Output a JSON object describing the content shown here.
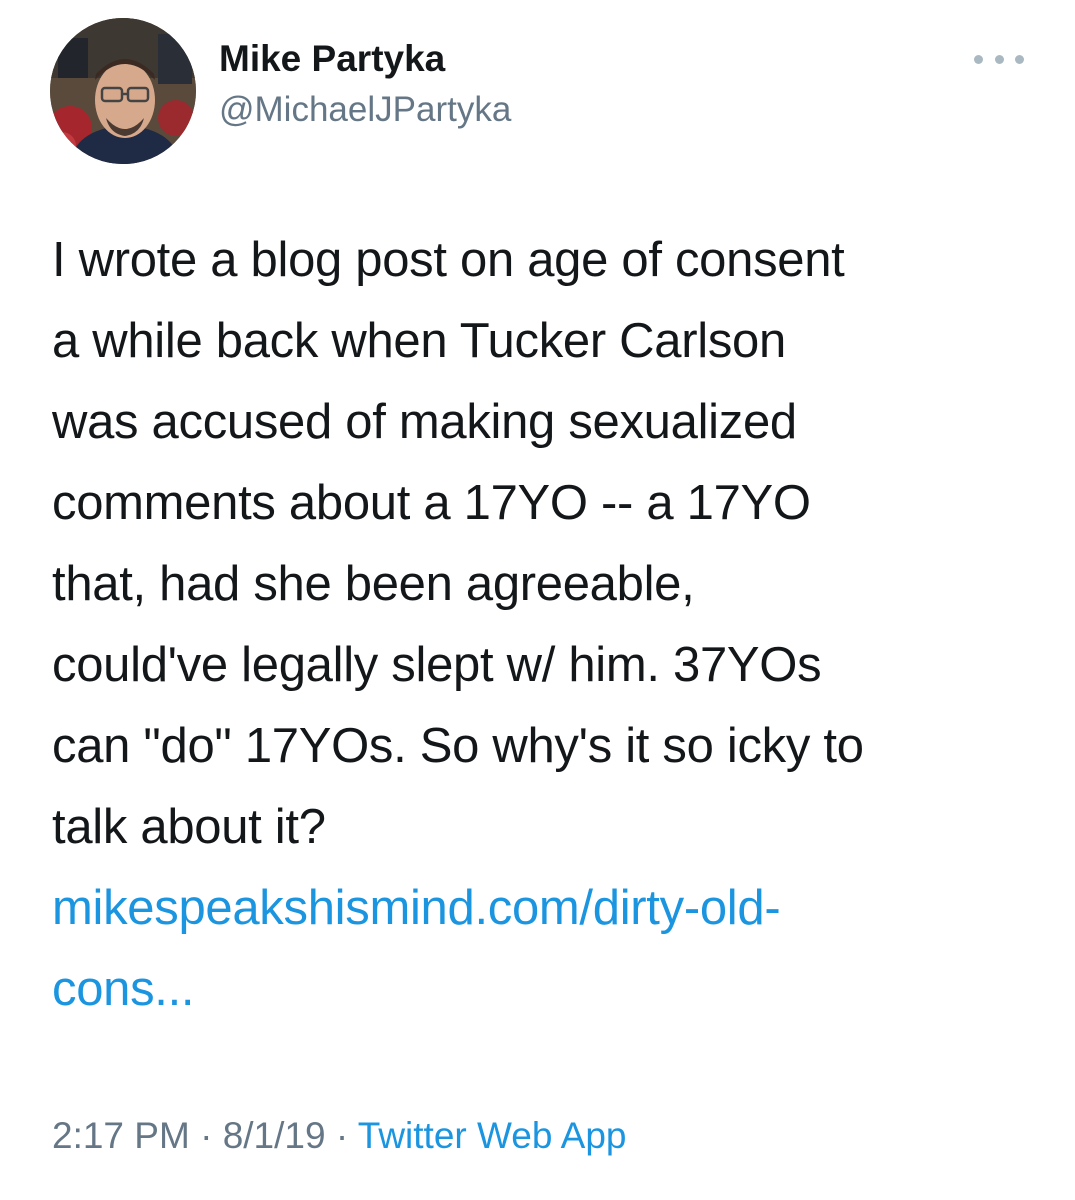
{
  "author": {
    "display_name": "Mike Partyka",
    "handle": "@MichaelJPartyka"
  },
  "tweet": {
    "text": "I wrote a blog post on age of consent\na while back when Tucker Carlson\nwas accused of making sexualized\ncomments about a 17YO -- a 17YO\nthat, had she been agreeable,\ncould've legally slept w/ him. 37YOs\ncan \"do\" 17YOs. So why's it so icky to\ntalk about it?",
    "link_text": "mikespeakshismind.com/dirty-old-\ncons..."
  },
  "meta": {
    "time": "2:17 PM",
    "separator_1": " · ",
    "date": "8/1/19",
    "separator_2": " · ",
    "source": "Twitter Web App"
  },
  "icons": {
    "more": "more-dots-icon",
    "avatar": "profile-photo"
  },
  "colors": {
    "text": "#14171a",
    "secondary": "#657786",
    "link": "#1b95e0"
  }
}
